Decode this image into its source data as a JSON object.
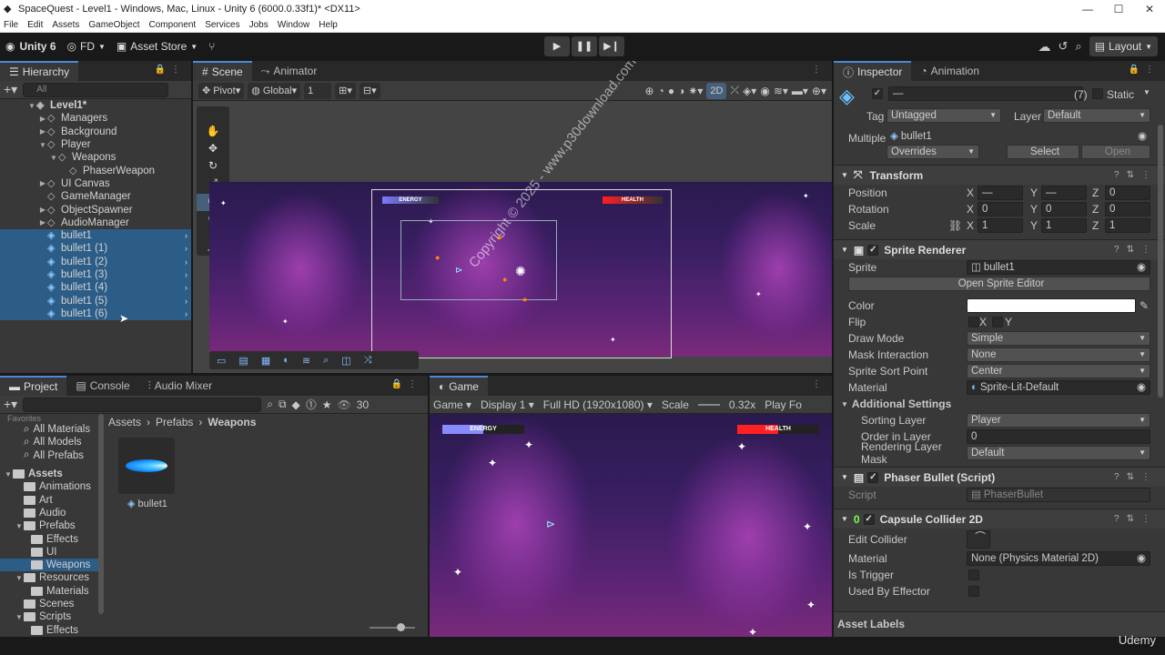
{
  "window": {
    "title": "SpaceQuest - Level1 - Windows, Mac, Linux - Unity 6 (6000.0.33f1)* <DX11>"
  },
  "menu": [
    "File",
    "Edit",
    "Assets",
    "GameObject",
    "Component",
    "Services",
    "Jobs",
    "Window",
    "Help"
  ],
  "toolbar": {
    "unity_label": "Unity 6",
    "account": "FD",
    "asset_store": "Asset Store",
    "layout": "Layout"
  },
  "hierarchy": {
    "tab": "Hierarchy",
    "search_placeholder": "All",
    "scene": "Level1*",
    "items": [
      {
        "label": "Managers",
        "indent": 1,
        "arrow": "▶",
        "sel": false
      },
      {
        "label": "Background",
        "indent": 1,
        "arrow": "▶",
        "sel": false
      },
      {
        "label": "Player",
        "indent": 1,
        "arrow": "▼",
        "sel": false
      },
      {
        "label": "Weapons",
        "indent": 2,
        "arrow": "▼",
        "sel": false
      },
      {
        "label": "PhaserWeapon",
        "indent": 3,
        "arrow": "",
        "sel": false
      },
      {
        "label": "UI Canvas",
        "indent": 1,
        "arrow": "▶",
        "sel": false
      },
      {
        "label": "GameManager",
        "indent": 1,
        "arrow": "",
        "sel": false
      },
      {
        "label": "ObjectSpawner",
        "indent": 1,
        "arrow": "▶",
        "sel": false
      },
      {
        "label": "AudioManager",
        "indent": 1,
        "arrow": "▶",
        "sel": false
      },
      {
        "label": "bullet1",
        "indent": 1,
        "arrow": "",
        "sel": true
      },
      {
        "label": "bullet1 (1)",
        "indent": 1,
        "arrow": "",
        "sel": true
      },
      {
        "label": "bullet1 (2)",
        "indent": 1,
        "arrow": "",
        "sel": true
      },
      {
        "label": "bullet1 (3)",
        "indent": 1,
        "arrow": "",
        "sel": true
      },
      {
        "label": "bullet1 (4)",
        "indent": 1,
        "arrow": "",
        "sel": true
      },
      {
        "label": "bullet1 (5)",
        "indent": 1,
        "arrow": "",
        "sel": true
      },
      {
        "label": "bullet1 (6)",
        "indent": 1,
        "arrow": "",
        "sel": true
      }
    ]
  },
  "scene": {
    "tabs": [
      "Scene",
      "Animator"
    ],
    "pivot": "Pivot",
    "global": "Global",
    "grid_value": "1",
    "mode_2d": "2D",
    "energy_label": "ENERGY",
    "health_label": "HEALTH",
    "tool_counter": "0"
  },
  "watermark": "Copyright © 2025 - www.p30download.com",
  "project": {
    "tabs": [
      "Project",
      "Console",
      "Audio Mixer"
    ],
    "favorites_label": "Favorites",
    "favorites": [
      "All Materials",
      "All Models",
      "All Prefabs"
    ],
    "assets_label": "Assets",
    "tree": [
      {
        "label": "Animations",
        "indent": 2,
        "arrow": ""
      },
      {
        "label": "Art",
        "indent": 2,
        "arrow": ""
      },
      {
        "label": "Audio",
        "indent": 2,
        "arrow": ""
      },
      {
        "label": "Prefabs",
        "indent": 2,
        "arrow": "▼"
      },
      {
        "label": "Effects",
        "indent": 3,
        "arrow": ""
      },
      {
        "label": "UI",
        "indent": 3,
        "arrow": ""
      },
      {
        "label": "Weapons",
        "indent": 3,
        "arrow": "",
        "sel": true
      },
      {
        "label": "Resources",
        "indent": 2,
        "arrow": "▼"
      },
      {
        "label": "Materials",
        "indent": 3,
        "arrow": ""
      },
      {
        "label": "Scenes",
        "indent": 2,
        "arrow": ""
      },
      {
        "label": "Scripts",
        "indent": 2,
        "arrow": "▼"
      },
      {
        "label": "Effects",
        "indent": 3,
        "arrow": ""
      }
    ],
    "breadcrumb": [
      "Assets",
      "Prefabs",
      "Weapons"
    ],
    "asset_name": "bullet1",
    "count": "30"
  },
  "game": {
    "tab": "Game",
    "mode": "Game",
    "display": "Display 1",
    "resolution": "Full HD (1920x1080)",
    "scale_label": "Scale",
    "scale_value": "0.32x",
    "play_focus": "Play Fo",
    "energy_label": "ENERGY",
    "health_label": "HEALTH"
  },
  "inspector": {
    "tabs": [
      "Inspector",
      "Animation"
    ],
    "name": "—",
    "count": "(7)",
    "static_label": "Static",
    "tag_label": "Tag",
    "tag": "Untagged",
    "layer_label": "Layer",
    "layer": "Default",
    "multiple_label": "Multiple",
    "multiple_value": "bullet1",
    "overrides": "Overrides",
    "select": "Select",
    "open": "Open",
    "transform": {
      "title": "Transform",
      "position_label": "Position",
      "position": [
        "—",
        "—",
        "0"
      ],
      "rotation_label": "Rotation",
      "rotation": [
        "0",
        "0",
        "0"
      ],
      "scale_label": "Scale",
      "scale": [
        "1",
        "1",
        "1"
      ]
    },
    "sprite_renderer": {
      "title": "Sprite Renderer",
      "sprite_label": "Sprite",
      "sprite": "bullet1",
      "open_editor": "Open Sprite Editor",
      "color_label": "Color",
      "color_value": "#ffffff",
      "flip_label": "Flip",
      "flip_x": "X",
      "flip_y": "Y",
      "draw_mode_label": "Draw Mode",
      "draw_mode": "Simple",
      "mask_label": "Mask Interaction",
      "mask": "None",
      "sort_point_label": "Sprite Sort Point",
      "sort_point": "Center",
      "material_label": "Material",
      "material": "Sprite-Lit-Default",
      "additional_label": "Additional Settings",
      "sorting_layer_label": "Sorting Layer",
      "sorting_layer": "Player",
      "order_label": "Order in Layer",
      "order": "0",
      "render_mask_label": "Rendering Layer Mask",
      "render_mask": "Default"
    },
    "phaser_bullet": {
      "title": "Phaser Bullet (Script)",
      "script_label": "Script",
      "script": "PhaserBullet"
    },
    "capsule": {
      "title": "Capsule Collider 2D",
      "edit_label": "Edit Collider",
      "material_label": "Material",
      "material": "None (Physics Material 2D)",
      "trigger_label": "Is Trigger",
      "effector_label": "Used By Effector"
    },
    "asset_labels": "Asset Labels"
  },
  "status": {
    "brand": "Udemy"
  }
}
